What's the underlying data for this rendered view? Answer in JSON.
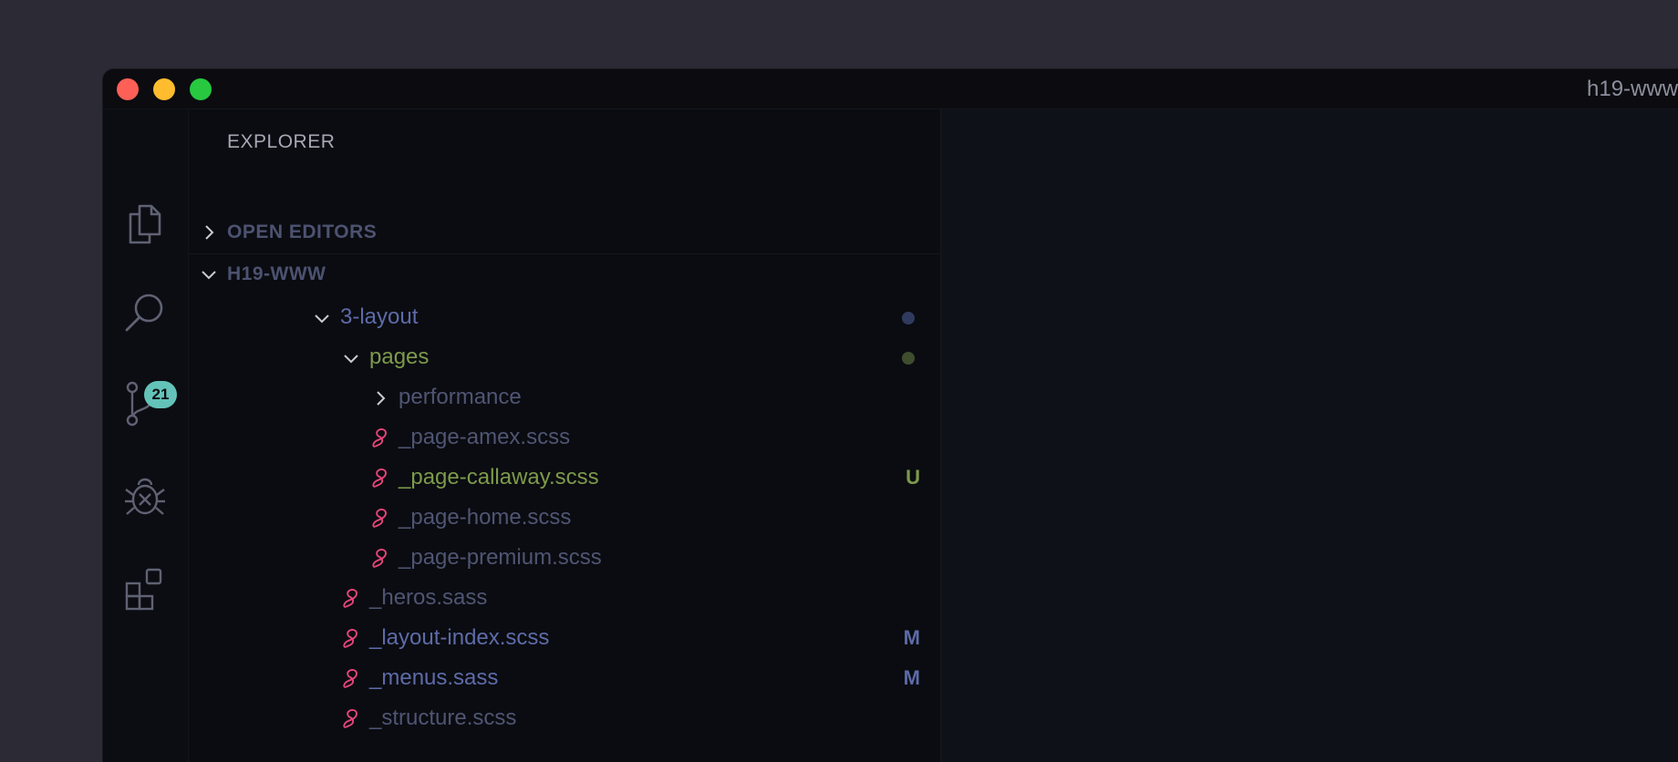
{
  "window": {
    "title": "h19-www"
  },
  "activity_bar": {
    "items": [
      {
        "name": "explorer",
        "icon": "files-icon"
      },
      {
        "name": "search",
        "icon": "search-icon"
      },
      {
        "name": "source-control",
        "icon": "source-control-icon",
        "badge": "21"
      },
      {
        "name": "debug",
        "icon": "debug-icon"
      },
      {
        "name": "extensions",
        "icon": "extensions-icon"
      }
    ]
  },
  "sidebar": {
    "title": "EXPLORER",
    "sections": [
      {
        "label": "OPEN EDITORS",
        "expanded": false
      },
      {
        "label": "H19-WWW",
        "expanded": true
      }
    ],
    "tree": [
      {
        "label": "3-layout",
        "type": "folder",
        "expanded": true,
        "color": "#5d6ba8",
        "decoration": "dot",
        "decoration_color": "#2f3a5e"
      },
      {
        "label": "pages",
        "type": "folder",
        "expanded": true,
        "color": "#7d9a4c",
        "decoration": "dot",
        "decoration_color": "#3f4d2e"
      },
      {
        "label": "performance",
        "type": "folder",
        "expanded": false,
        "color": "#4f5573"
      },
      {
        "label": "_page-amex.scss",
        "type": "file",
        "icon": "sass-icon",
        "color": "#4f5573"
      },
      {
        "label": "_page-callaway.scss",
        "type": "file",
        "icon": "sass-icon",
        "color": "#7d9a4c",
        "status": "U",
        "status_color": "#7d9a4c"
      },
      {
        "label": "_page-home.scss",
        "type": "file",
        "icon": "sass-icon",
        "color": "#4f5573"
      },
      {
        "label": "_page-premium.scss",
        "type": "file",
        "icon": "sass-icon",
        "color": "#4f5573"
      },
      {
        "label": "_heros.sass",
        "type": "file",
        "icon": "sass-icon",
        "color": "#4f5573"
      },
      {
        "label": "_layout-index.scss",
        "type": "file",
        "icon": "sass-icon",
        "color": "#5d6ba8",
        "status": "M",
        "status_color": "#5d6ba8"
      },
      {
        "label": "_menus.sass",
        "type": "file",
        "icon": "sass-icon",
        "color": "#5d6ba8",
        "status": "M",
        "status_color": "#5d6ba8"
      },
      {
        "label": "_structure.scss",
        "type": "file",
        "icon": "sass-icon",
        "color": "#4f5573"
      }
    ]
  },
  "colors": {
    "sass_icon": "#e8457a",
    "badge": "#64c3b9",
    "activity_icon": "#5f6273"
  }
}
